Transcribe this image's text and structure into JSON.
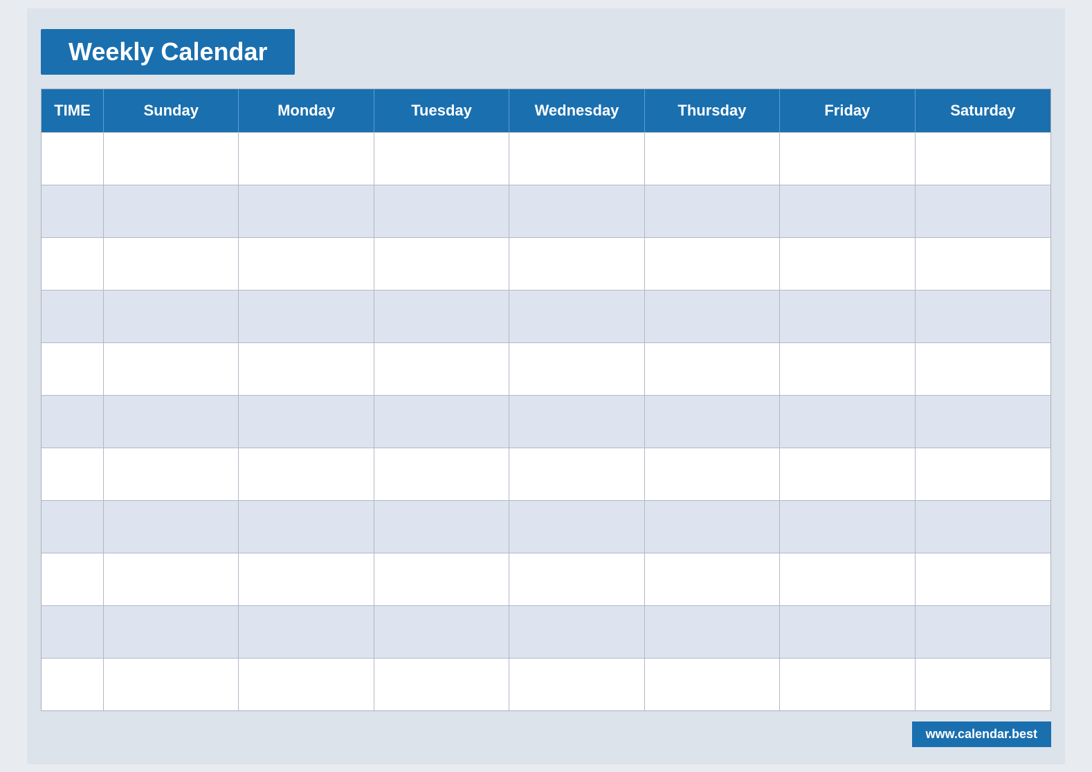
{
  "header": {
    "title": "Weekly Calendar"
  },
  "columns": {
    "time_label": "TIME",
    "days": [
      "Sunday",
      "Monday",
      "Tuesday",
      "Wednesday",
      "Thursday",
      "Friday",
      "Saturday"
    ]
  },
  "rows": {
    "count": 11
  },
  "footer": {
    "url": "www.calendar.best"
  },
  "colors": {
    "primary_blue": "#1a6faf",
    "light_row": "#dde3ef",
    "border": "#b0b8c8"
  }
}
